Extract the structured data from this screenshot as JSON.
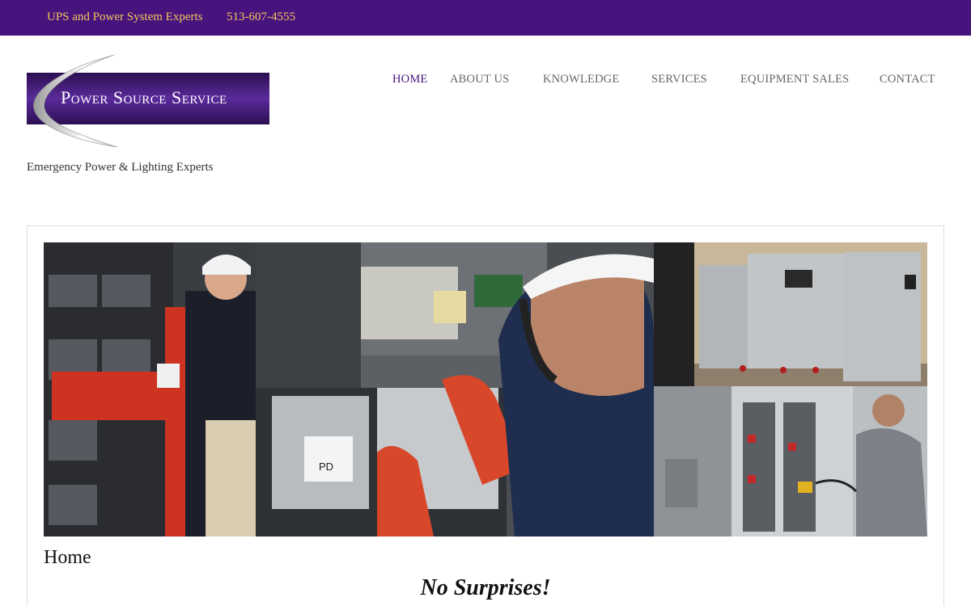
{
  "topbar": {
    "tagline": "UPS and Power System Experts",
    "phone": "513-607-4555"
  },
  "brand": {
    "name": "Power Source Service",
    "description": "Emergency Power & Lighting Experts"
  },
  "nav": {
    "items": [
      {
        "label": "HOME",
        "active": true
      },
      {
        "label": "ABOUT US",
        "active": false
      },
      {
        "label": "KNOWLEDGE",
        "active": false
      },
      {
        "label": "SERVICES",
        "active": false
      },
      {
        "label": "EQUIPMENT SALES",
        "active": false
      },
      {
        "label": "CONTACT",
        "active": false
      }
    ]
  },
  "hero": {
    "battery_label": "PD"
  },
  "page": {
    "title": "Home",
    "slogan": "No Surprises!"
  },
  "colors": {
    "brand_purple": "#47147e",
    "tagline_gold": "#f2c75c",
    "nav_text": "#666666"
  }
}
